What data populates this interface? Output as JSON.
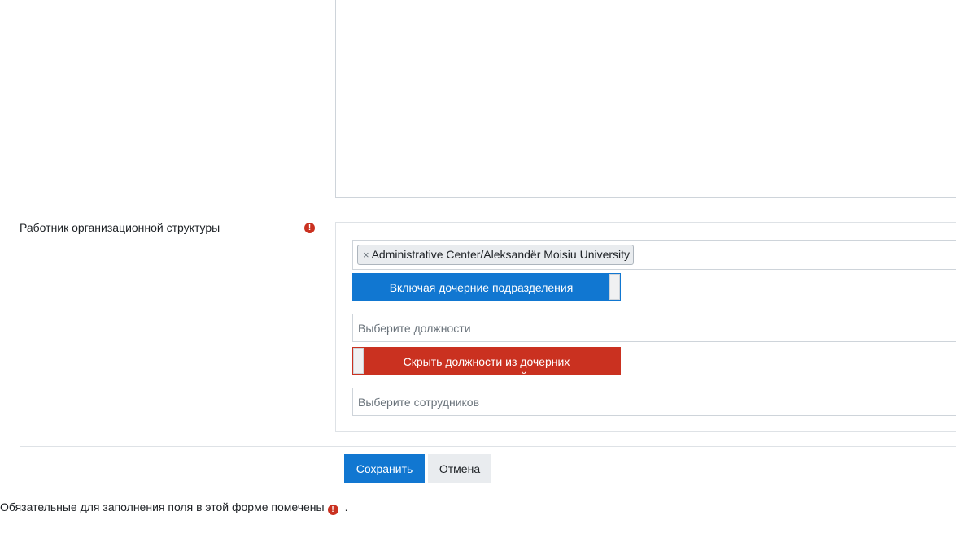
{
  "field": {
    "label": "Работник организационной структуры",
    "required_icon": "exclamation-circle-icon"
  },
  "org_select": {
    "tag_remove": "×",
    "tag_label": "Administrative Center/Aleksandër Moisiu University"
  },
  "toggles": {
    "include_children": "Включая дочерние подразделения",
    "hide_child_positions": "Скрыть должности из дочерних подразделений"
  },
  "inputs": {
    "positions_placeholder": "Выберите должности",
    "employees_placeholder": "Выберите сотрудников"
  },
  "buttons": {
    "save": "Сохранить",
    "cancel": "Отмена"
  },
  "footer": {
    "required_note": "Обязательные для заполнения поля в этой форме помечены",
    "required_note_end": "."
  },
  "colors": {
    "primary": "#1177d1",
    "danger": "#ca3120"
  }
}
